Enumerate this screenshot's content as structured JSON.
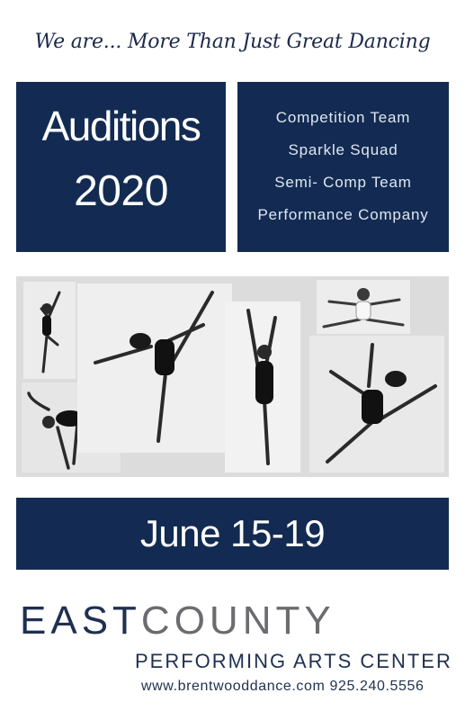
{
  "tagline": "We are... More Than Just Great Dancing",
  "auditions": {
    "title": "Auditions",
    "year": "2020"
  },
  "teams": [
    "Competition Team",
    "Sparkle Squad",
    "Semi- Comp Team",
    "Performance Company"
  ],
  "date": "June 15-19",
  "logo": {
    "part1": "EAST",
    "part2": "COUNTY",
    "subtitle": "PERFORMING ARTS CENTER"
  },
  "contact": {
    "website": "www.brentwooddance.com",
    "phone": "925.240.5556"
  },
  "colors": {
    "navy": "#132b52",
    "logo_gray": "#6b6b70",
    "photo_bg": "#dcdcdc"
  }
}
